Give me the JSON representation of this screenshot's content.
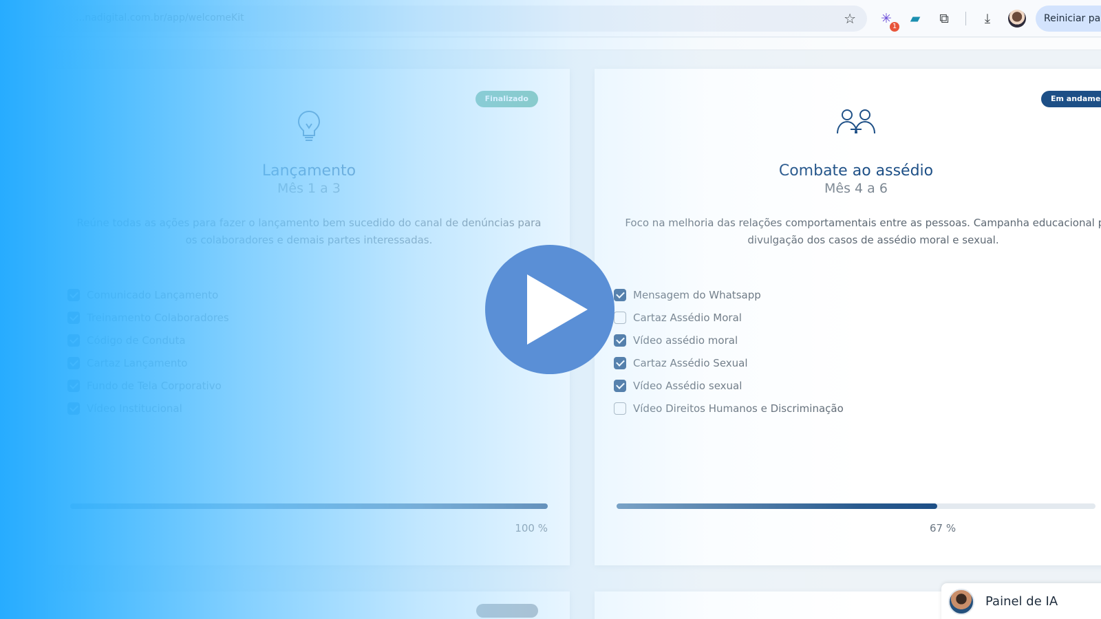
{
  "browser": {
    "url": "...nadigital.com.br/app/welcomeKit",
    "restart_label": "Reiniciar para",
    "extension_badge": "1",
    "icons": [
      "star-icon",
      "extension-spark-icon",
      "chat-extension-icon",
      "puzzle-icon",
      "download-icon",
      "profile-avatar"
    ]
  },
  "cards": [
    {
      "status": "Finalizado",
      "icon": "lightbulb-icon",
      "title": "Lançamento",
      "subtitle": "Mês 1 a 3",
      "description": "Reúne todas as ações para fazer o lançamento bem sucedido do canal de denúncias para os colaboradores e demais partes interessadas.",
      "tasks": [
        {
          "label": "Comunicado Lançamento",
          "checked": true
        },
        {
          "label": "Treinamento Colaboradores",
          "checked": true
        },
        {
          "label": "Código de Conduta",
          "checked": true
        },
        {
          "label": "Cartaz Lançamento",
          "checked": true
        },
        {
          "label": "Fundo de Tela Corporativo",
          "checked": true
        },
        {
          "label": "Vídeo Institucional",
          "checked": true
        }
      ],
      "progress": 1.0,
      "progress_label": "100 %"
    },
    {
      "status": "Em andamento",
      "icon": "people-handshake-icon",
      "title": "Combate ao assédio",
      "subtitle": "Mês 4 a 6",
      "description": "Foco na melhoria das relações comportamentais entre as pessoas. Campanha educacional para divulgação dos casos de assédio moral e sexual.",
      "tasks": [
        {
          "label": "Mensagem do Whatsapp",
          "checked": true
        },
        {
          "label": "Cartaz Assédio Moral",
          "checked": false
        },
        {
          "label": "Vídeo assédio moral",
          "checked": true
        },
        {
          "label": "Cartaz Assédio Sexual",
          "checked": true
        },
        {
          "label": "Vídeo Assédio sexual",
          "checked": true
        },
        {
          "label": "Vídeo Direitos Humanos e Discriminação",
          "checked": false
        }
      ],
      "progress": 0.67,
      "progress_label": "67 %"
    }
  ],
  "ai_panel": {
    "label": "Painel de IA"
  },
  "colors": {
    "accent": "#1d4f86",
    "done": "#5fb6a2",
    "overlay": "#27acff",
    "play": "#5a8fd6"
  }
}
